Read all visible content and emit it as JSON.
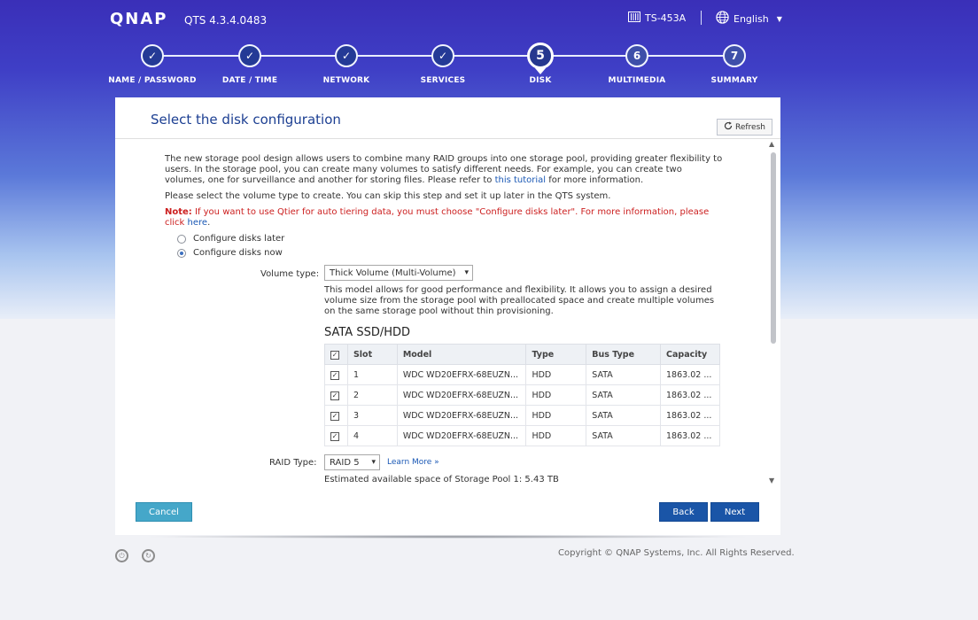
{
  "header": {
    "logo": "QNAP",
    "version": "QTS 4.3.4.0483",
    "device": "TS-453A",
    "language": "English"
  },
  "steps": [
    {
      "num": "✓",
      "label": "NAME / PASSWORD",
      "state": "done"
    },
    {
      "num": "✓",
      "label": "DATE / TIME",
      "state": "done"
    },
    {
      "num": "✓",
      "label": "NETWORK",
      "state": "done"
    },
    {
      "num": "✓",
      "label": "SERVICES",
      "state": "done"
    },
    {
      "num": "5",
      "label": "DISK",
      "state": "current"
    },
    {
      "num": "6",
      "label": "MULTIMEDIA",
      "state": "future"
    },
    {
      "num": "7",
      "label": "SUMMARY",
      "state": "future"
    }
  ],
  "panel": {
    "title": "Select the disk configuration",
    "refresh_label": "Refresh",
    "intro_before_link": "The new storage pool design allows users to combine many RAID groups into one storage pool, providing greater flexibility to users. In the storage pool, you can create many volumes to satisfy different needs. For example, you can create two volumes, one for surveillance and another for storing files. Please refer to ",
    "intro_link": "this tutorial",
    "intro_after_link": " for more information.",
    "select_text": "Please select the volume type to create. You can skip this step and set it up later in the QTS system.",
    "note_label": "Note:",
    "note_text": " If you want to use Qtier for auto tiering data, you must choose \"Configure disks later\". For more information, please click ",
    "note_link": "here",
    "note_end": ".",
    "options": [
      {
        "label": "Configure disks later",
        "selected": false
      },
      {
        "label": "Configure disks now",
        "selected": true
      }
    ],
    "volume_type_label": "Volume type:",
    "volume_type_value": "Thick Volume (Multi-Volume)",
    "volume_desc": "This model allows for good performance and flexibility. It allows you to assign a desired volume size from the storage pool with preallocated space and create multiple volumes on the same storage pool without thin provisioning.",
    "sata_title": "SATA SSD/HDD",
    "table": {
      "headers": [
        "Slot",
        "Model",
        "Type",
        "Bus Type",
        "Capacity"
      ],
      "rows": [
        {
          "slot": "1",
          "model": "WDC WD20EFRX-68EUZN...",
          "type": "HDD",
          "bus": "SATA",
          "capacity": "1863.02 ..."
        },
        {
          "slot": "2",
          "model": "WDC WD20EFRX-68EUZN...",
          "type": "HDD",
          "bus": "SATA",
          "capacity": "1863.02 ..."
        },
        {
          "slot": "3",
          "model": "WDC WD20EFRX-68EUZN...",
          "type": "HDD",
          "bus": "SATA",
          "capacity": "1863.02 ..."
        },
        {
          "slot": "4",
          "model": "WDC WD20EFRX-68EUZN...",
          "type": "HDD",
          "bus": "SATA",
          "capacity": "1863.02 ..."
        }
      ]
    },
    "raid_label": "RAID Type:",
    "raid_value": "RAID 5",
    "learn_more": "Learn More »",
    "estimate": "Estimated available space of Storage Pool 1: 5.43 TB",
    "cancel_label": "Cancel",
    "back_label": "Back",
    "next_label": "Next"
  },
  "footer": {
    "copyright": "Copyright © QNAP Systems, Inc. All Rights Reserved."
  },
  "colors": {
    "accent": "#1a55a7",
    "cancel": "#45a7c9",
    "note": "#cc2020",
    "title": "#1c3f92"
  }
}
